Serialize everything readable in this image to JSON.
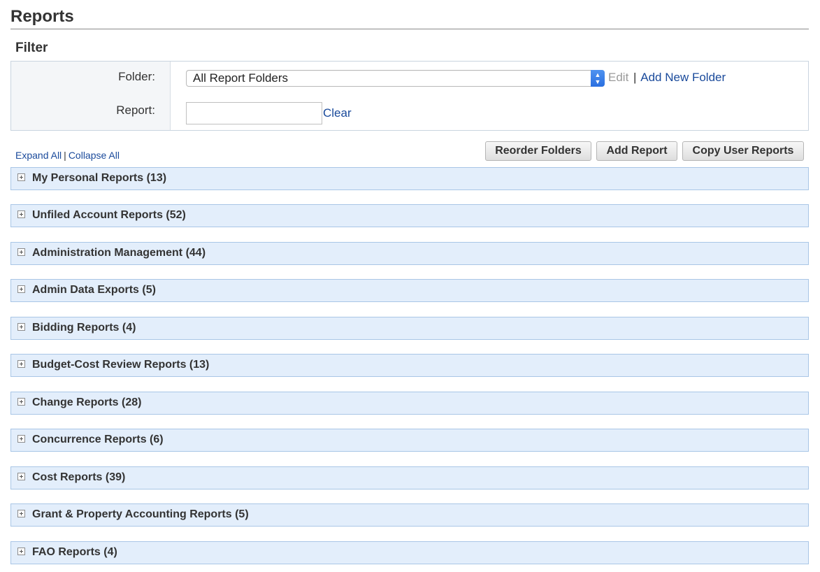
{
  "page": {
    "title": "Reports"
  },
  "filter": {
    "heading": "Filter",
    "folder_label": "Folder:",
    "folder_value": "All Report Folders",
    "edit_label": "Edit",
    "separator": "|",
    "add_folder_label": "Add New Folder",
    "report_label": "Report:",
    "report_value": "",
    "clear_label": "Clear"
  },
  "controls": {
    "expand_all": "Expand All",
    "collapse_all": "Collapse All",
    "separator": "|",
    "reorder_folders": "Reorder Folders",
    "add_report": "Add Report",
    "copy_user_reports": "Copy User Reports"
  },
  "folders": [
    {
      "label": "My Personal Reports (13)"
    },
    {
      "label": "Unfiled Account Reports (52)"
    },
    {
      "label": "Administration Management (44)"
    },
    {
      "label": "Admin Data Exports (5)"
    },
    {
      "label": "Bidding Reports (4)"
    },
    {
      "label": "Budget-Cost Review Reports (13)"
    },
    {
      "label": "Change Reports (28)"
    },
    {
      "label": "Concurrence Reports (6)"
    },
    {
      "label": "Cost Reports (39)"
    },
    {
      "label": "Grant & Property Accounting Reports (5)"
    },
    {
      "label": "FAO Reports (4)"
    }
  ],
  "colors": {
    "link": "#1a4a9b",
    "folder_row_bg": "#e3eefb",
    "folder_row_border": "#a9c6e6",
    "select_accent": "#2a6fe0"
  },
  "icons": {
    "folder_expand": "plus-box-icon",
    "select": "select-arrows-icon"
  }
}
